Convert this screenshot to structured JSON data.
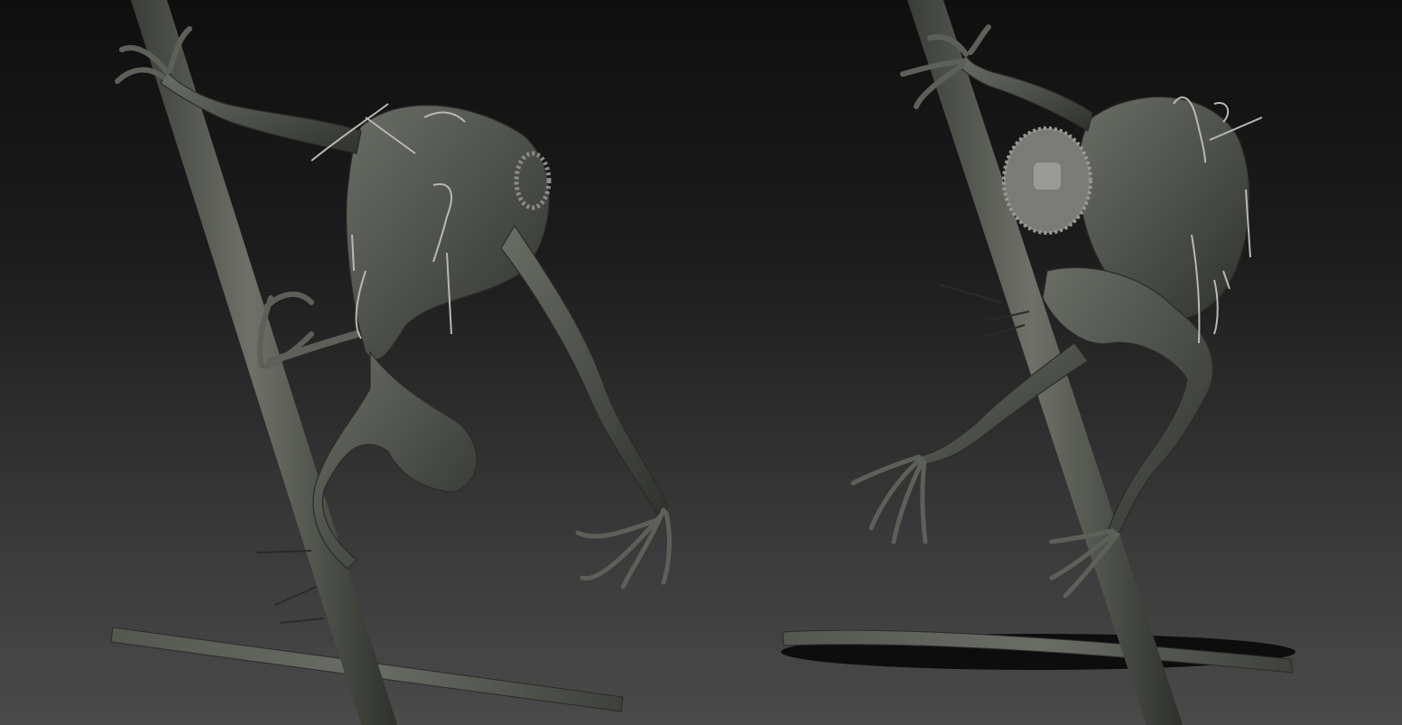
{
  "scene": {
    "description_visible_text": "",
    "colors": {
      "background_top": "#0f0f0f",
      "background_bottom": "#4a4a4a",
      "sculpt_clay": "#4e514b",
      "sculpt_clay_light": "#6b6e67",
      "sculpt_clay_dark": "#2f312d",
      "metal_wire": "#b8b8b4",
      "gear": "#8c8c88"
    },
    "views": [
      {
        "name": "front-three-quarter-view"
      },
      {
        "name": "back-three-quarter-view"
      }
    ]
  }
}
